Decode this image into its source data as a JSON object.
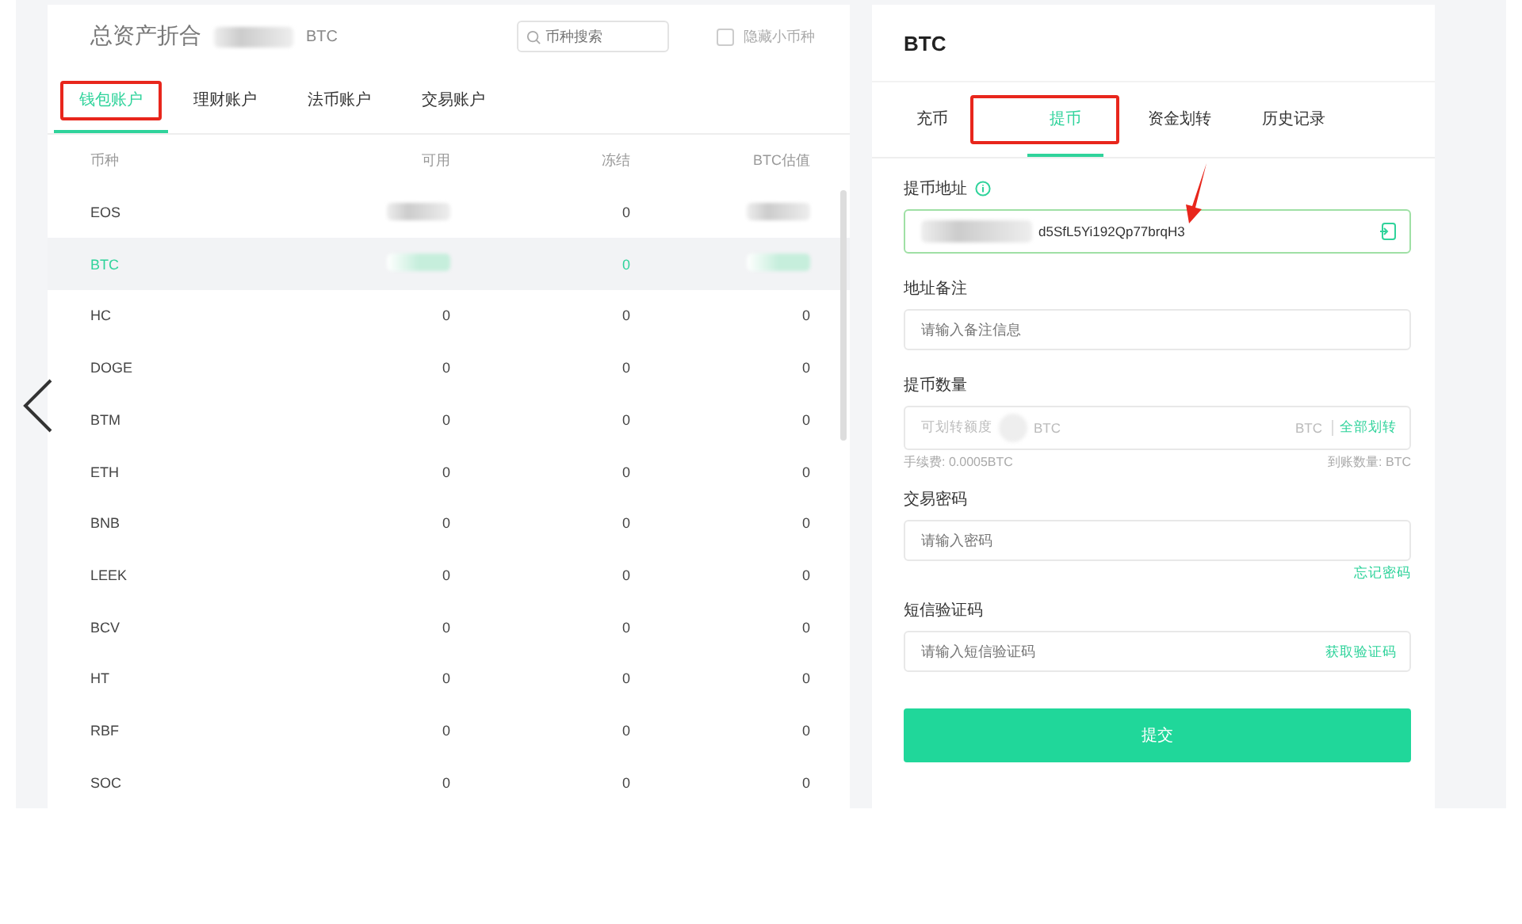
{
  "assets": {
    "title": "总资产折合",
    "unit": "BTC",
    "search": {
      "placeholder": "币种搜索"
    },
    "hide_small": {
      "label": "隐藏小币种",
      "checked": false
    },
    "tabs": [
      {
        "label": "钱包账户",
        "selected": true,
        "highlighted": true
      },
      {
        "label": "理财账户",
        "selected": false,
        "highlighted": false
      },
      {
        "label": "法币账户",
        "selected": false,
        "highlighted": false
      },
      {
        "label": "交易账户",
        "selected": false,
        "highlighted": false
      }
    ],
    "table": {
      "columns": [
        "币种",
        "可用",
        "冻结",
        "BTC估值"
      ],
      "rows": [
        {
          "selected": false,
          "cells": [
            {
              "kind": "text",
              "text": "EOS"
            },
            {
              "kind": "redacted"
            },
            {
              "kind": "text",
              "text": "0"
            },
            {
              "kind": "redacted"
            }
          ]
        },
        {
          "selected": true,
          "cells": [
            {
              "kind": "text",
              "text": "BTC"
            },
            {
              "kind": "redacted"
            },
            {
              "kind": "text",
              "text": "0"
            },
            {
              "kind": "redacted"
            }
          ]
        },
        {
          "selected": false,
          "cells": [
            {
              "kind": "text",
              "text": "HC"
            },
            {
              "kind": "text",
              "text": "0"
            },
            {
              "kind": "text",
              "text": "0"
            },
            {
              "kind": "text",
              "text": "0"
            }
          ]
        },
        {
          "selected": false,
          "cells": [
            {
              "kind": "text",
              "text": "DOGE"
            },
            {
              "kind": "text",
              "text": "0"
            },
            {
              "kind": "text",
              "text": "0"
            },
            {
              "kind": "text",
              "text": "0"
            }
          ]
        },
        {
          "selected": false,
          "cells": [
            {
              "kind": "text",
              "text": "BTM"
            },
            {
              "kind": "text",
              "text": "0"
            },
            {
              "kind": "text",
              "text": "0"
            },
            {
              "kind": "text",
              "text": "0"
            }
          ]
        },
        {
          "selected": false,
          "cells": [
            {
              "kind": "text",
              "text": "ETH"
            },
            {
              "kind": "text",
              "text": "0"
            },
            {
              "kind": "text",
              "text": "0"
            },
            {
              "kind": "text",
              "text": "0"
            }
          ]
        },
        {
          "selected": false,
          "cells": [
            {
              "kind": "text",
              "text": "BNB"
            },
            {
              "kind": "text",
              "text": "0"
            },
            {
              "kind": "text",
              "text": "0"
            },
            {
              "kind": "text",
              "text": "0"
            }
          ]
        },
        {
          "selected": false,
          "cells": [
            {
              "kind": "text",
              "text": "LEEK"
            },
            {
              "kind": "text",
              "text": "0"
            },
            {
              "kind": "text",
              "text": "0"
            },
            {
              "kind": "text",
              "text": "0"
            }
          ]
        },
        {
          "selected": false,
          "cells": [
            {
              "kind": "text",
              "text": "BCV"
            },
            {
              "kind": "text",
              "text": "0"
            },
            {
              "kind": "text",
              "text": "0"
            },
            {
              "kind": "text",
              "text": "0"
            }
          ]
        },
        {
          "selected": false,
          "cells": [
            {
              "kind": "text",
              "text": "HT"
            },
            {
              "kind": "text",
              "text": "0"
            },
            {
              "kind": "text",
              "text": "0"
            },
            {
              "kind": "text",
              "text": "0"
            }
          ]
        },
        {
          "selected": false,
          "cells": [
            {
              "kind": "text",
              "text": "RBF"
            },
            {
              "kind": "text",
              "text": "0"
            },
            {
              "kind": "text",
              "text": "0"
            },
            {
              "kind": "text",
              "text": "0"
            }
          ]
        },
        {
          "selected": false,
          "cells": [
            {
              "kind": "text",
              "text": "SOC"
            },
            {
              "kind": "text",
              "text": "0"
            },
            {
              "kind": "text",
              "text": "0"
            },
            {
              "kind": "text",
              "text": "0"
            }
          ]
        }
      ]
    }
  },
  "withdraw": {
    "title": "BTC",
    "tabs": [
      {
        "label": "充币",
        "selected": false,
        "highlighted": false
      },
      {
        "label": "提币",
        "selected": true,
        "highlighted": true
      },
      {
        "label": "资金划转",
        "selected": false,
        "highlighted": false
      },
      {
        "label": "历史记录",
        "selected": false,
        "highlighted": false
      }
    ],
    "address": {
      "label": "提币地址",
      "value": "d5SfL5Yi192Qp77brqH3",
      "arrow_marked": true
    },
    "note": {
      "label": "地址备注",
      "placeholder": "请输入备注信息"
    },
    "amount": {
      "label": "提币数量",
      "placeholder_prefix": "可划转额度",
      "placeholder_suffix": "BTC",
      "unit": "BTC",
      "action": "全部划转",
      "fee": "手续费: 0.0005BTC",
      "receive": "到账数量: BTC"
    },
    "password": {
      "label": "交易密码",
      "placeholder": "请输入密码",
      "link": "忘记密码"
    },
    "sms": {
      "label": "短信验证码",
      "placeholder": "请输入短信验证码",
      "action": "获取验证码"
    },
    "submit": "提交"
  }
}
